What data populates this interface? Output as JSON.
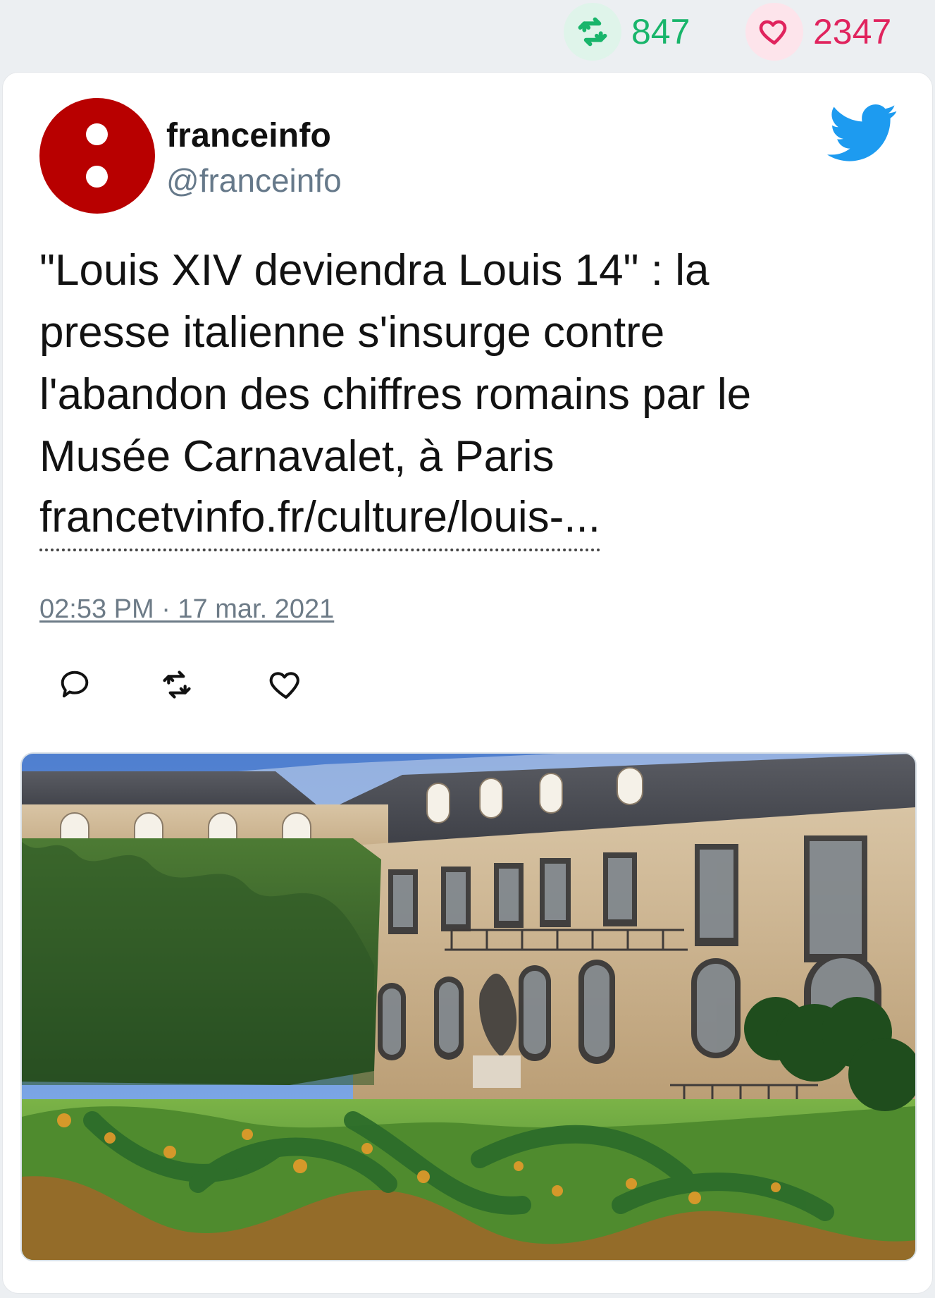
{
  "stats": {
    "retweets": "847",
    "likes": "2347"
  },
  "account": {
    "name": "franceinfo",
    "handle": "@franceinfo"
  },
  "tweet": {
    "text": "\"Louis XIV deviendra Louis 14\" : la\npresse italienne s'insurge contre\nl'abandon des chiffres romains par le\nMusée Carnavalet, à Paris",
    "link": "francetvinfo.fr/culture/louis-...",
    "timestamp": "02:53 PM · 17 mar. 2021"
  },
  "icons": {
    "top_retweet": "retweet-icon",
    "top_like": "heart-icon",
    "brand": "twitter-bird-icon",
    "reply": "reply-icon",
    "retweet": "retweet-icon",
    "like": "heart-icon"
  },
  "colors": {
    "retweet": "#19b56b",
    "like": "#e0245e",
    "twitter": "#1d9bf0",
    "avatar_bg": "#b80000"
  }
}
